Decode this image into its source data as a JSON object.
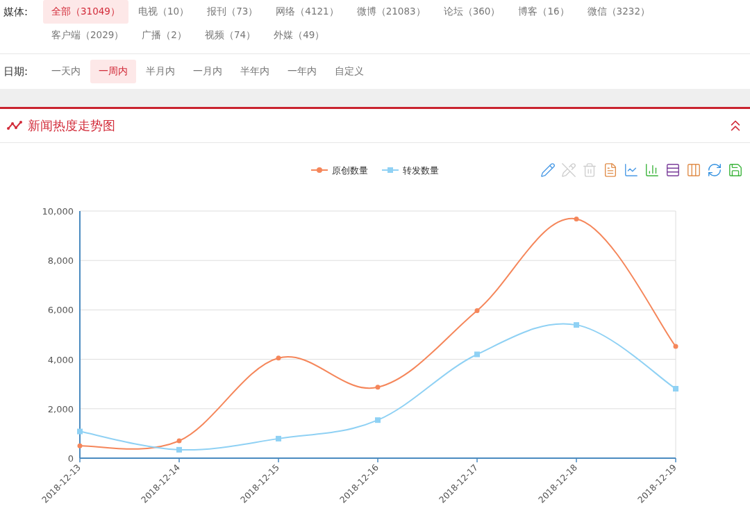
{
  "media_filter": {
    "label": "媒体:",
    "items": [
      {
        "label": "全部（31049）",
        "selected": true
      },
      {
        "label": "电视（10）",
        "selected": false
      },
      {
        "label": "报刊（73）",
        "selected": false
      },
      {
        "label": "网络（4121）",
        "selected": false
      },
      {
        "label": "微博（21083）",
        "selected": false
      },
      {
        "label": "论坛（360）",
        "selected": false
      },
      {
        "label": "博客（16）",
        "selected": false
      },
      {
        "label": "微信（3232）",
        "selected": false
      },
      {
        "label": "客户端（2029）",
        "selected": false
      },
      {
        "label": "广播（2）",
        "selected": false
      },
      {
        "label": "视频（74）",
        "selected": false
      },
      {
        "label": "外媒（49）",
        "selected": false
      }
    ]
  },
  "date_filter": {
    "label": "日期:",
    "items": [
      {
        "label": "一天内",
        "selected": false
      },
      {
        "label": "一周内",
        "selected": true
      },
      {
        "label": "半月内",
        "selected": false
      },
      {
        "label": "一月内",
        "selected": false
      },
      {
        "label": "半年内",
        "selected": false
      },
      {
        "label": "一年内",
        "selected": false
      },
      {
        "label": "自定义",
        "selected": false
      }
    ]
  },
  "panel": {
    "title": "新闻热度走势图",
    "expanded": true,
    "toolbar": [
      {
        "kind": "pencil-plus",
        "disabled": false
      },
      {
        "kind": "pencil-minus",
        "disabled": true
      },
      {
        "kind": "trash",
        "disabled": true
      },
      {
        "kind": "document",
        "disabled": false
      },
      {
        "kind": "line",
        "disabled": false
      },
      {
        "kind": "bar",
        "disabled": false
      },
      {
        "kind": "rows",
        "disabled": false
      },
      {
        "kind": "columns",
        "disabled": false
      },
      {
        "kind": "refresh",
        "disabled": false
      },
      {
        "kind": "save",
        "disabled": false
      }
    ],
    "chart_data": {
      "type": "line",
      "categories": [
        "2018-12-13",
        "2018-12-14",
        "2018-12-15",
        "2018-12-16",
        "2018-12-17",
        "2018-12-18",
        "2018-12-19"
      ],
      "series": [
        {
          "name": "原创数量",
          "color": "#f5865a",
          "marker": "circle",
          "values": [
            500,
            700,
            4050,
            2870,
            5970,
            9680,
            4520
          ]
        },
        {
          "name": "转发数量",
          "color": "#8fd1f4",
          "marker": "square",
          "values": [
            1080,
            340,
            790,
            1540,
            4200,
            5390,
            2810
          ]
        }
      ],
      "ylim": [
        0,
        10000
      ],
      "grid": true,
      "legend": true,
      "yticks": [
        {
          "value": 0,
          "label": "0"
        },
        {
          "value": 2000,
          "label": "2,000"
        },
        {
          "value": 4000,
          "label": "4,000"
        },
        {
          "value": 6000,
          "label": "6,000"
        },
        {
          "value": 8000,
          "label": "8,000"
        },
        {
          "value": 10000,
          "label": "10,000"
        }
      ]
    }
  }
}
